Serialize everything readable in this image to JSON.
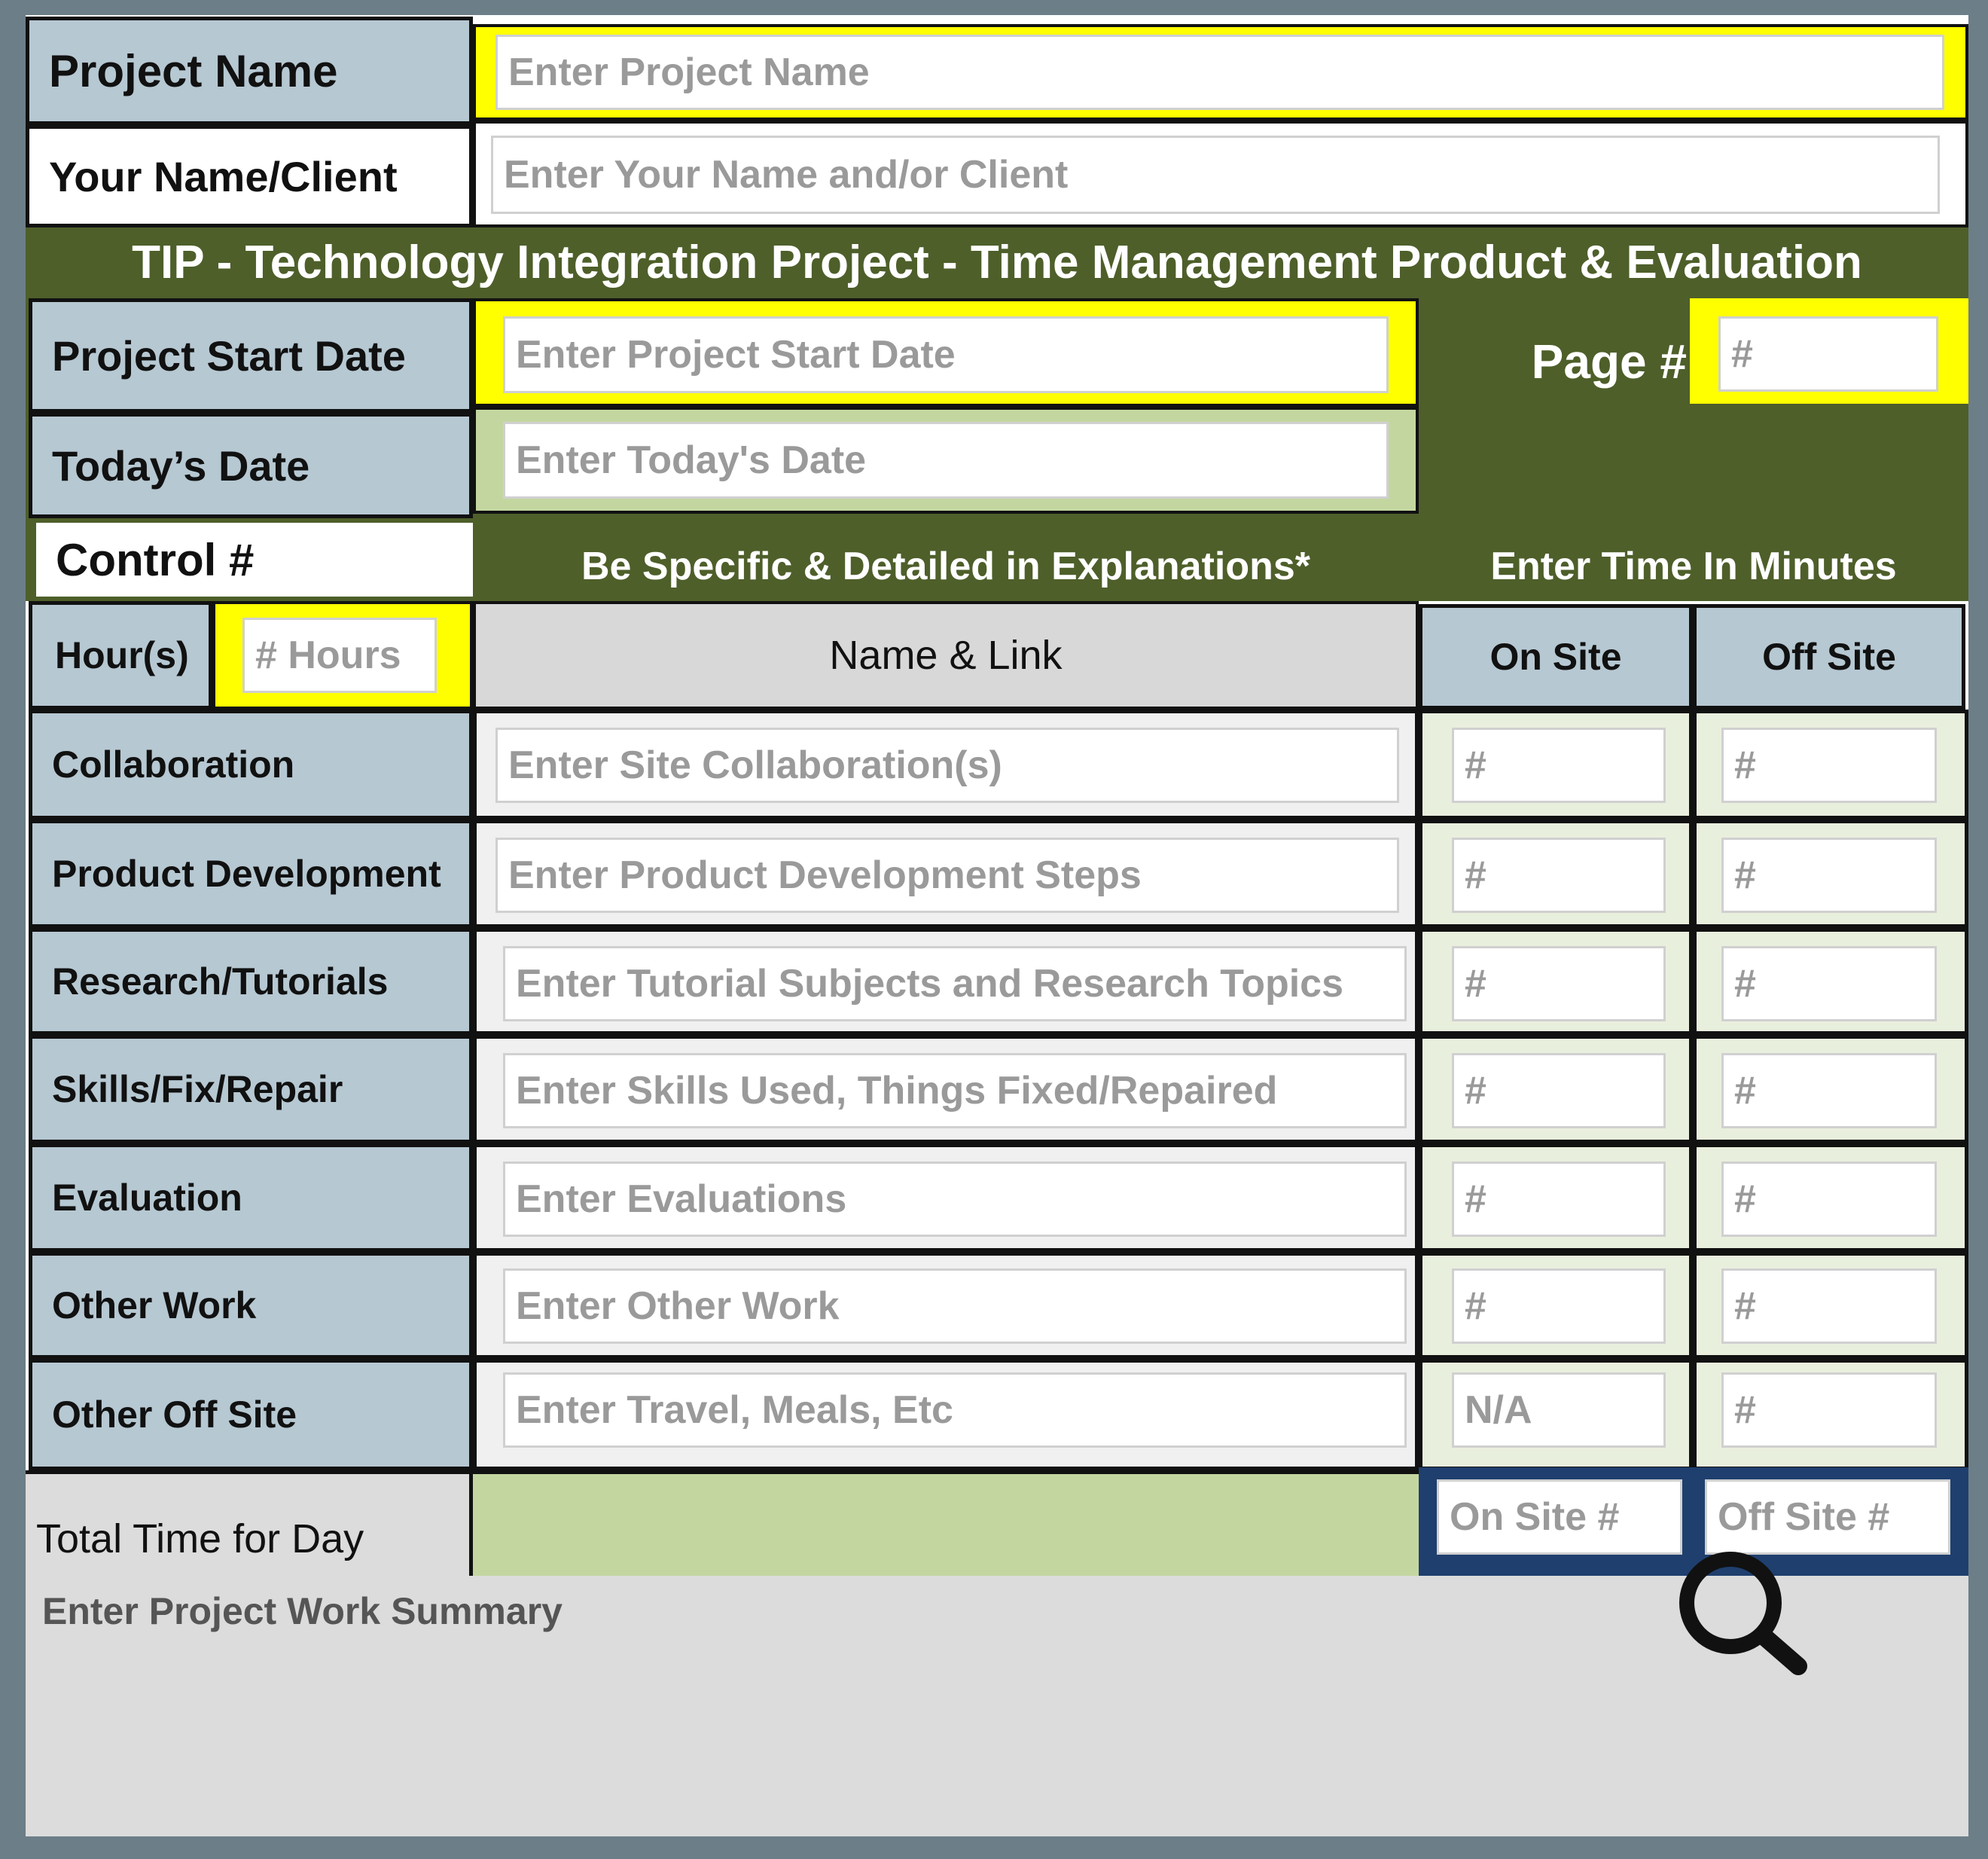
{
  "header": {
    "project_name_label": "Project Name",
    "project_name_placeholder": "Enter Project Name",
    "your_name_label": "Your Name/Client",
    "your_name_placeholder": "Enter Your Name and/or Client",
    "banner_title": "TIP - Technology Integration Project - Time Management Product & Evaluation"
  },
  "dates": {
    "start_label": "Project Start Date",
    "start_placeholder": "Enter Project Start Date",
    "today_label": "Today’s Date",
    "today_placeholder": "Enter Today's Date",
    "page_label": "Page #",
    "page_placeholder": "#",
    "control_label": "Control #"
  },
  "instructions": {
    "explanations": "Be Specific & Detailed in Explanations*",
    "minutes": "Enter Time In Minutes"
  },
  "table": {
    "hours_label": "Hour(s)",
    "hours_placeholder": "# Hours",
    "name_link_header": "Name & Link",
    "on_site_header": "On Site",
    "off_site_header": "Off Site",
    "rows": [
      {
        "label": "Collaboration",
        "placeholder": "Enter Site Collaboration(s)",
        "on_site": "#",
        "off_site": "#"
      },
      {
        "label": "Product Development",
        "placeholder": "Enter Product Development Steps",
        "on_site": "#",
        "off_site": "#"
      },
      {
        "label": "Research/Tutorials",
        "placeholder": "Enter Tutorial Subjects and Research Topics",
        "on_site": "#",
        "off_site": "#"
      },
      {
        "label": "Skills/Fix/Repair",
        "placeholder": "Enter Skills Used, Things Fixed/Repaired",
        "on_site": "#",
        "off_site": "#"
      },
      {
        "label": "Evaluation",
        "placeholder": "Enter Evaluations",
        "on_site": "#",
        "off_site": "#"
      },
      {
        "label": "Other Work",
        "placeholder": "Enter Other Work",
        "on_site": "#",
        "off_site": "#"
      },
      {
        "label": "Other Off Site",
        "placeholder": "Enter Travel, Meals, Etc",
        "on_site": "N/A",
        "off_site": "#"
      }
    ]
  },
  "totals": {
    "label": "Total Time for Day",
    "on_site_placeholder": "On Site #",
    "off_site_placeholder": "Off Site #"
  },
  "summary": {
    "placeholder": "Enter Project Work Summary"
  },
  "icons": {
    "zoom": "search-icon"
  },
  "colors": {
    "label_blue": "#b6c8d2",
    "highlight_yellow": "#ffff00",
    "banner_green": "#4e5f2a",
    "light_green": "#c4d6a0",
    "totals_navy": "#1f3f6e"
  }
}
